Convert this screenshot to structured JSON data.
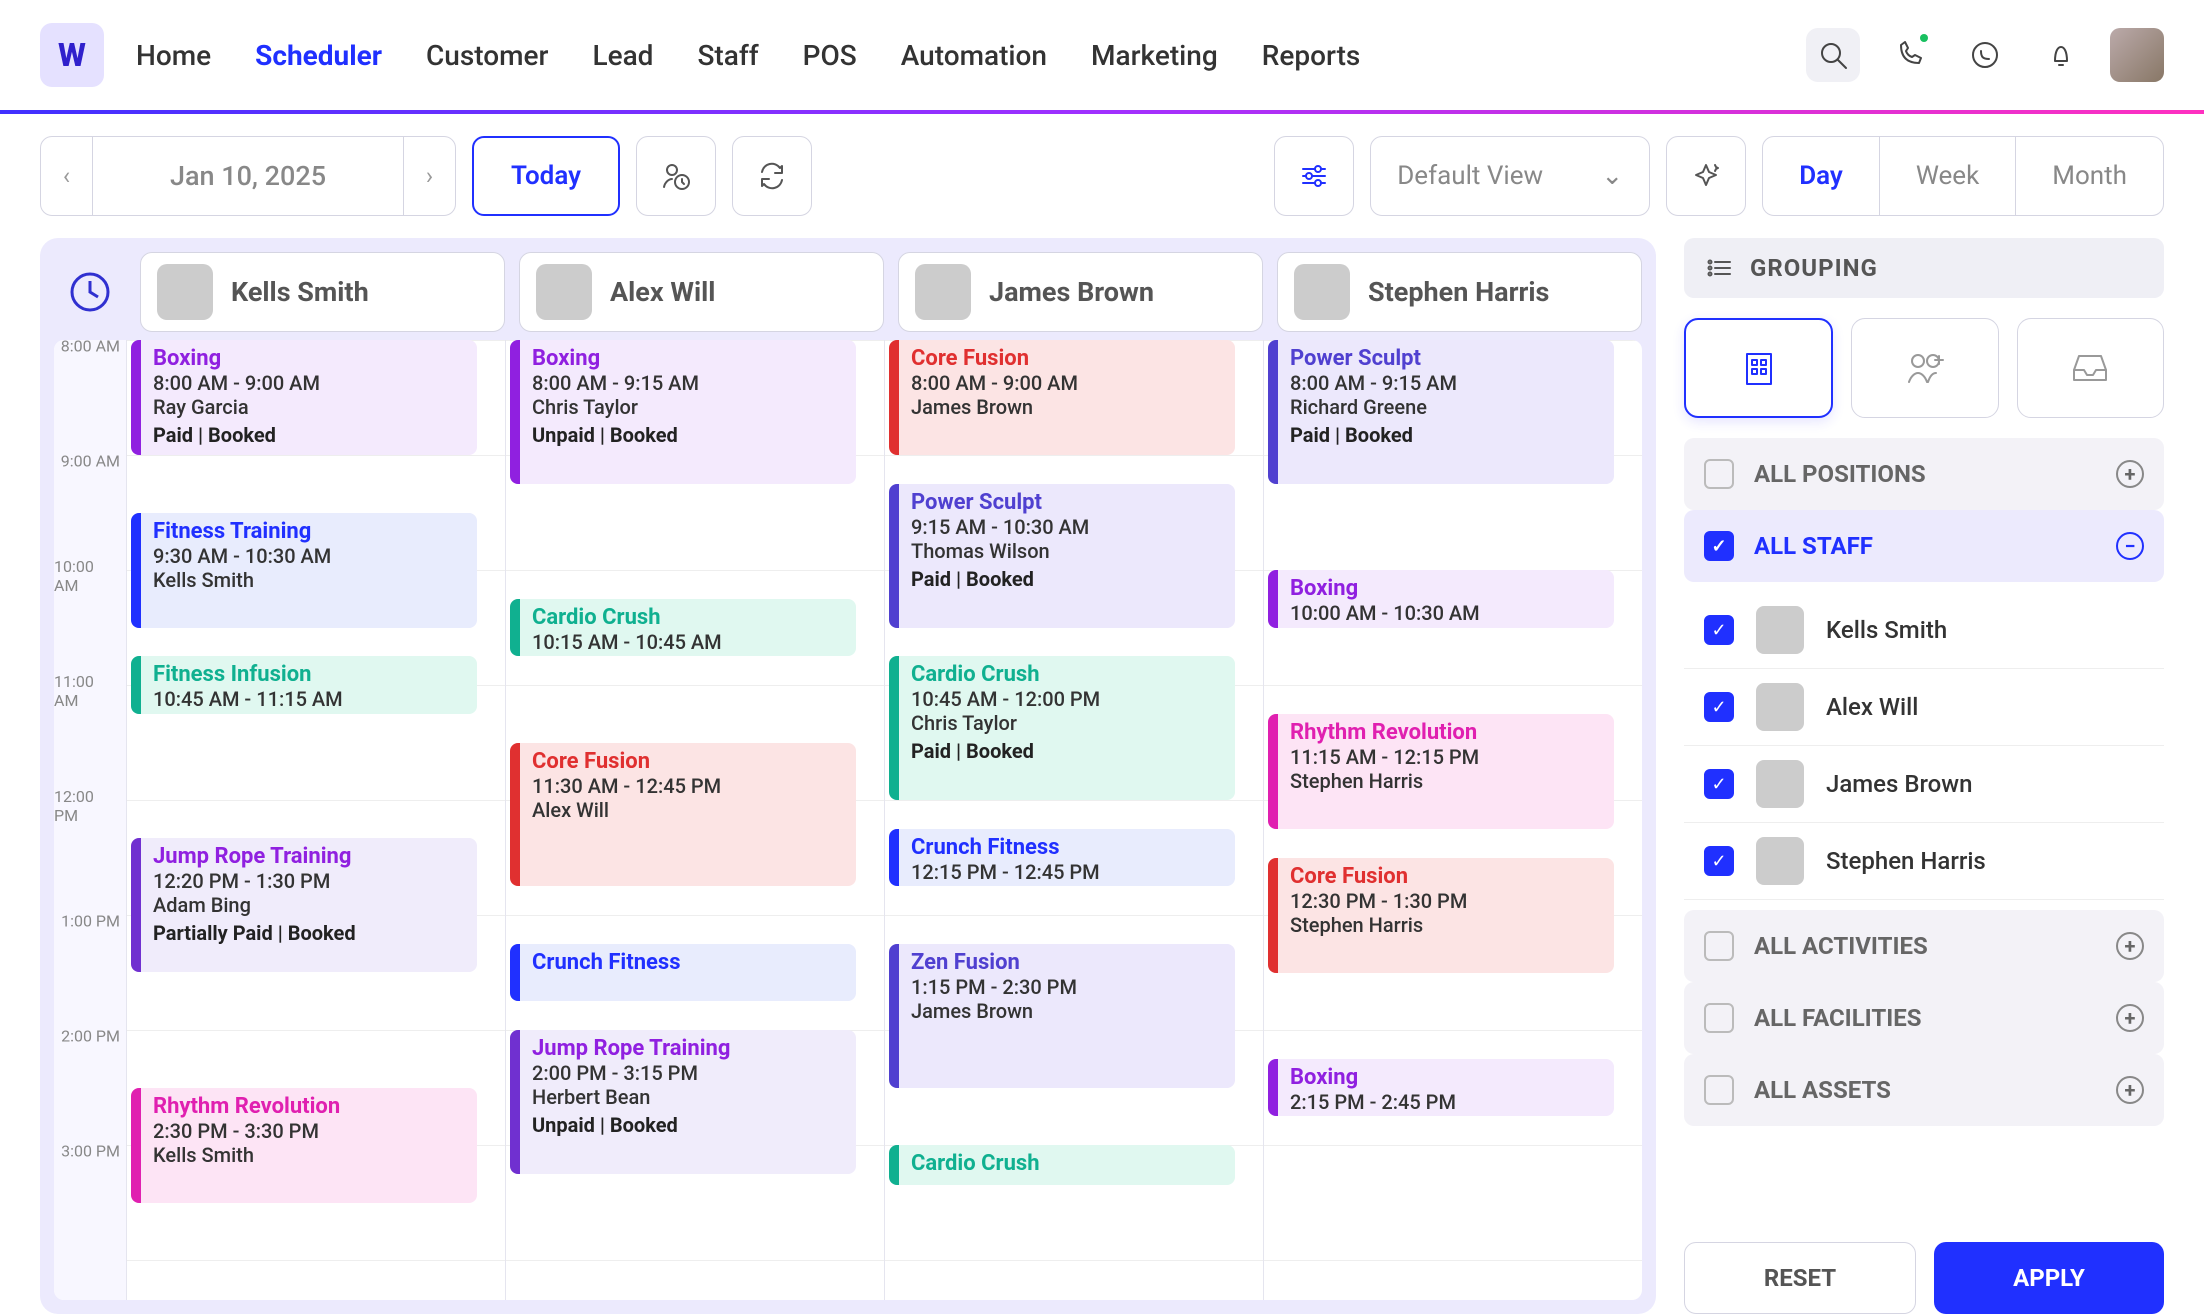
{
  "nav": {
    "items": [
      "Home",
      "Scheduler",
      "Customer",
      "Lead",
      "Staff",
      "POS",
      "Automation",
      "Marketing",
      "Reports"
    ],
    "active_index": 1
  },
  "toolbar": {
    "date": "Jan 10, 2025",
    "today": "Today",
    "view_select": "Default View",
    "day": "Day",
    "week": "Week",
    "month": "Month"
  },
  "time_labels": [
    "8:00 AM",
    "9:00 AM",
    "10:00 AM",
    "11:00 AM",
    "12:00 PM",
    "1:00 PM",
    "2:00 PM",
    "3:00 PM"
  ],
  "staff": [
    {
      "name": "Kells Smith"
    },
    {
      "name": "Alex Will"
    },
    {
      "name": "James Brown"
    },
    {
      "name": "Stephen Harris"
    }
  ],
  "events": {
    "col0": [
      {
        "title": "Boxing",
        "time": "8:00 AM - 9:00 AM",
        "who": "Ray Garcia",
        "status": "Paid | Booked",
        "start": 8,
        "end": 9,
        "cls": "c-purple"
      },
      {
        "title": "Fitness Training",
        "time": "9:30 AM - 10:30 AM",
        "who": "Kells Smith",
        "status": "",
        "start": 9.5,
        "end": 10.5,
        "cls": "c-blue"
      },
      {
        "title": "Fitness Infusion",
        "time": "10:45 AM - 11:15 AM",
        "who": "",
        "status": "",
        "start": 10.75,
        "end": 11.25,
        "cls": "c-teal"
      },
      {
        "title": "Jump Rope Training",
        "time": "12:20 PM - 1:30 PM",
        "who": "Adam Bing",
        "status": "Partially Paid | Booked",
        "start": 12.33,
        "end": 13.5,
        "cls": "c-purple-b"
      },
      {
        "title": "Rhythm Revolution",
        "time": "2:30 PM - 3:30 PM",
        "who": "Kells Smith",
        "status": "",
        "start": 14.5,
        "end": 15.5,
        "cls": "c-pink"
      }
    ],
    "col1": [
      {
        "title": "Boxing",
        "time": "8:00 AM - 9:15 AM",
        "who": "Chris Taylor",
        "status": "Unpaid | Booked",
        "start": 8,
        "end": 9.25,
        "cls": "c-purple"
      },
      {
        "title": "Cardio Crush",
        "time": "10:15 AM - 10:45 AM",
        "who": "",
        "status": "",
        "start": 10.25,
        "end": 10.75,
        "cls": "c-teal"
      },
      {
        "title": "Core Fusion",
        "time": "11:30 AM - 12:45 PM",
        "who": "Alex Will",
        "status": "",
        "start": 11.5,
        "end": 12.75,
        "cls": "c-red"
      },
      {
        "title": "Crunch Fitness",
        "time": "",
        "who": "",
        "status": "",
        "start": 13.25,
        "end": 13.75,
        "cls": "c-blue"
      },
      {
        "title": "Jump Rope Training",
        "time": "2:00 PM - 3:15 PM",
        "who": "Herbert Bean",
        "status": "Unpaid | Booked",
        "start": 14,
        "end": 15.25,
        "cls": "c-purple-b"
      }
    ],
    "col2": [
      {
        "title": "Core Fusion",
        "time": "8:00 AM - 9:00 AM",
        "who": "James Brown",
        "status": "",
        "start": 8,
        "end": 9,
        "cls": "c-red"
      },
      {
        "title": "Power Sculpt",
        "time": "9:15 AM - 10:30 AM",
        "who": "Thomas Wilson",
        "status": "Paid | Booked",
        "start": 9.25,
        "end": 10.5,
        "cls": "c-indigo"
      },
      {
        "title": "Cardio Crush",
        "time": "10:45 AM - 12:00 PM",
        "who": "Chris Taylor",
        "status": "Paid | Booked",
        "start": 10.75,
        "end": 12,
        "cls": "c-teal"
      },
      {
        "title": "Crunch Fitness",
        "time": "12:15 PM - 12:45 PM",
        "who": "",
        "status": "",
        "start": 12.25,
        "end": 12.75,
        "cls": "c-blue"
      },
      {
        "title": "Zen Fusion",
        "time": "1:15 PM - 2:30 PM",
        "who": "James Brown",
        "status": "",
        "start": 13.25,
        "end": 14.5,
        "cls": "c-indigo"
      },
      {
        "title": "Cardio Crush",
        "time": "",
        "who": "",
        "status": "",
        "start": 15,
        "end": 15.35,
        "cls": "c-teal"
      }
    ],
    "col3": [
      {
        "title": "Power Sculpt",
        "time": "8:00 AM - 9:15 AM",
        "who": "Richard Greene",
        "status": "Paid | Booked",
        "start": 8,
        "end": 9.25,
        "cls": "c-indigo"
      },
      {
        "title": "Boxing",
        "time": "10:00 AM - 10:30 AM",
        "who": "",
        "status": "",
        "start": 10,
        "end": 10.5,
        "cls": "c-purple"
      },
      {
        "title": "Rhythm Revolution",
        "time": "11:15 AM - 12:15 PM",
        "who": "Stephen Harris",
        "status": "",
        "start": 11.25,
        "end": 12.25,
        "cls": "c-pink"
      },
      {
        "title": "Core Fusion",
        "time": "12:30 PM - 1:30 PM",
        "who": "Stephen Harris",
        "status": "",
        "start": 12.5,
        "end": 13.5,
        "cls": "c-red"
      },
      {
        "title": "Boxing",
        "time": "2:15 PM - 2:45 PM",
        "who": "",
        "status": "",
        "start": 14.25,
        "end": 14.75,
        "cls": "c-purple"
      }
    ]
  },
  "sidebar": {
    "grouping_label": "GROUPING",
    "all_positions": "ALL POSITIONS",
    "all_staff": "ALL STAFF",
    "all_activities": "ALL ACTIVITIES",
    "all_facilities": "ALL FACILITIES",
    "all_assets": "ALL ASSETS",
    "reset": "RESET",
    "apply": "APPLY",
    "staff_list": [
      "Kells Smith",
      "Alex Will",
      "James Brown",
      "Stephen Harris"
    ]
  }
}
